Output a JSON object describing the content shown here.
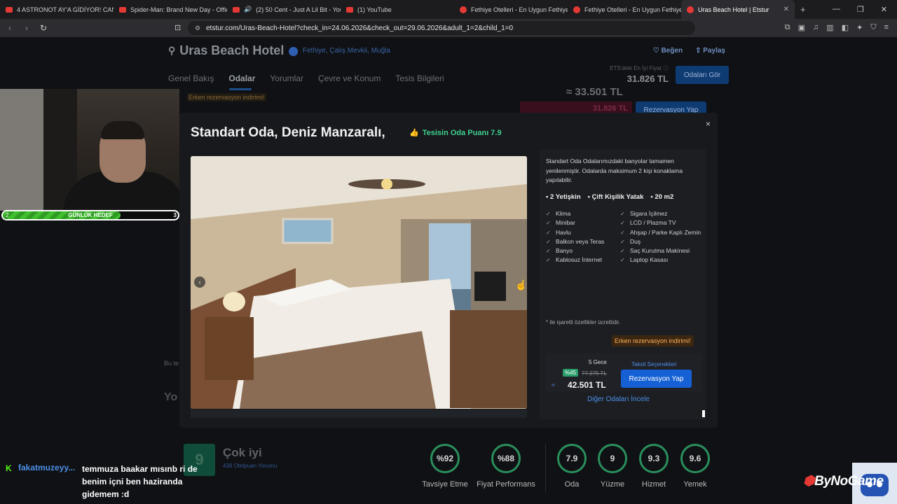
{
  "browser": {
    "tabs": [
      {
        "label": "4 ASTRONOT AY'A GİDİYOR! CANLI Y",
        "active": false
      },
      {
        "label": "Spider-Man: Brand New Day - Officia",
        "active": false
      },
      {
        "label": "(2) 50 Cent - Just A Lil Bit - YouTu",
        "active": false
      },
      {
        "label": "(1) YouTube",
        "active": false
      },
      {
        "label": "Fethiye Otelleri - En Uygun Fethiye O",
        "active": false
      },
      {
        "label": "Fethiye Otelleri - En Uygun Fethiye O",
        "active": false
      },
      {
        "label": "Uras Beach Hotel | Etstur",
        "active": true
      }
    ],
    "url": "etstur.com/Uras-Beach-Hotel?check_in=24.06.2026&check_out=29.06.2026&adult_1=2&child_1=0"
  },
  "hotel": {
    "name": "Uras Beach Hotel",
    "location": "Fethiye, Çalış Mevkii, Muğla",
    "like_label": "Beğen",
    "share_label": "Paylaş",
    "nav_tabs": [
      "Genel Bakış",
      "Odalar",
      "Yorumlar",
      "Çevre ve Konum",
      "Tesis Bilgileri"
    ],
    "best_price_label": "ETS'deki En İyi Fiyat",
    "best_price": "31.826 TL",
    "rooms_button": "Odaları Gör",
    "bg_price": "33.501 TL",
    "bg_special_price": "31.826 TL",
    "bg_rez_button": "Rezervasyon Yap",
    "bg_erken": "Erken rezervasyon indirimi!",
    "bg_text1": "Bu te",
    "bg_text2": "Yo"
  },
  "stream": {
    "goal_label": "GÜNLÜK HEDEF",
    "goal_current": "2",
    "goal_target": "3",
    "goal_progress": 0.67,
    "chat_user": "fakatmuzeyy...",
    "chat_message": "temmuza baakar mısınb ri de benim içni ben haziranda gidemem :d",
    "brand": "ByNoGame"
  },
  "modal": {
    "title": "Standart Oda, Deniz Manzaralı,",
    "score_label": "Tesisin Oda Puanı 7.9",
    "close": "×",
    "description": "Standart Oda Odalarımızdaki banyolar tamamen yenilenmiştir. Odalarda maksimum 2 kişi konaklama yapılabilir.",
    "specs": [
      "2 Yetişkin",
      "Çift Kişilik Yatak",
      "20 m2"
    ],
    "amenities": [
      "Klima",
      "Sigara İçilmez",
      "Minibar",
      "LCD / Plazma TV",
      "Havlu",
      "Ahşap / Parke Kaplı Zemin",
      "Balkon veya Teras",
      "Duş",
      "Banyo",
      "Saç Kurutma Makinesi",
      "Kablosuz İnternet",
      "Laptop Kasası"
    ],
    "note": "* ile işaretli özellikler ücretlidir.",
    "erken": "Erken rezervasyon indirimi!",
    "nights": "5 Gece",
    "taksit": "Taksit Seçenekleri",
    "discount": "%45",
    "old_price": "77.275 TL",
    "price": "42.501 TL",
    "rez_button": "Rezervasyon Yap",
    "other_rooms": "Diğer Odaları İncele",
    "prev_arrow": "‹"
  },
  "reviews": {
    "score": "9",
    "label": "Çok iyi",
    "count": "438 Otelpuan Yorumu",
    "rings": [
      {
        "value": "%92",
        "label": "Tavsiye Etme"
      },
      {
        "value": "%88",
        "label": "Fiyat Performans"
      },
      {
        "value": "7.9",
        "label": "Oda"
      },
      {
        "value": "9",
        "label": "Yüzme"
      },
      {
        "value": "9.3",
        "label": "Hizmet"
      },
      {
        "value": "9.6",
        "label": "Yemek"
      }
    ]
  }
}
